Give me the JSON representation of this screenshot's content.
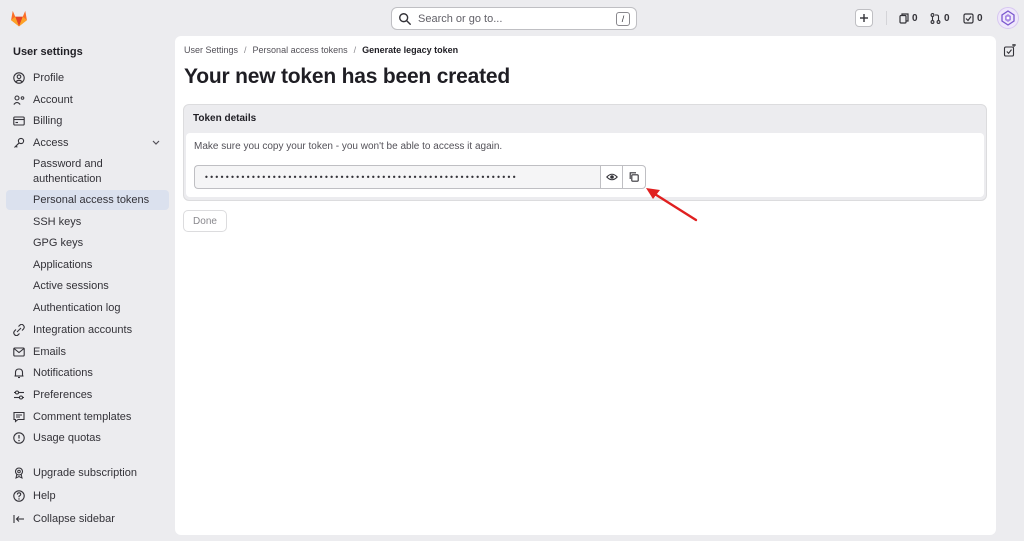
{
  "header": {
    "search": {
      "placeholder": "Search or go to...",
      "shortcut": "/"
    },
    "counters": {
      "issues": "0",
      "merge_requests": "0",
      "todos": "0"
    }
  },
  "sidebar": {
    "title": "User settings",
    "items": [
      {
        "label": "Profile",
        "icon": "profile-icon"
      },
      {
        "label": "Account",
        "icon": "account-icon"
      },
      {
        "label": "Billing",
        "icon": "billing-icon"
      },
      {
        "label": "Access",
        "icon": "key-icon"
      },
      {
        "label": "Password and authentication"
      },
      {
        "label": "Personal access tokens",
        "active": true
      },
      {
        "label": "SSH keys"
      },
      {
        "label": "GPG keys"
      },
      {
        "label": "Applications"
      },
      {
        "label": "Active sessions"
      },
      {
        "label": "Authentication log"
      },
      {
        "label": "Integration accounts",
        "icon": "integration-icon"
      },
      {
        "label": "Emails",
        "icon": "mail-icon"
      },
      {
        "label": "Notifications",
        "icon": "bell-icon"
      },
      {
        "label": "Preferences",
        "icon": "preferences-icon"
      },
      {
        "label": "Comment templates",
        "icon": "comment-icon"
      },
      {
        "label": "Usage quotas",
        "icon": "quota-icon"
      },
      {
        "label": "Upgrade subscription",
        "icon": "upgrade-icon"
      },
      {
        "label": "Help",
        "icon": "help-icon"
      },
      {
        "label": "Collapse sidebar",
        "icon": "collapse-icon"
      }
    ]
  },
  "breadcrumb": [
    "User Settings",
    "Personal access tokens",
    "Generate legacy token"
  ],
  "page": {
    "title": "Your new token has been created",
    "card": {
      "header": "Token details",
      "help_text": "Make sure you copy your token - you won't be able to access it again.",
      "token_value": "••••••••••••••••••••••••••••••••••••••••••••••••••••••••••••"
    },
    "done_label": "Done"
  },
  "colors": {
    "background": "#ececef",
    "active_nav": "#dbe1ee",
    "annotation_arrow": "#e02020",
    "gitlab_orange": "#fc6d26"
  }
}
